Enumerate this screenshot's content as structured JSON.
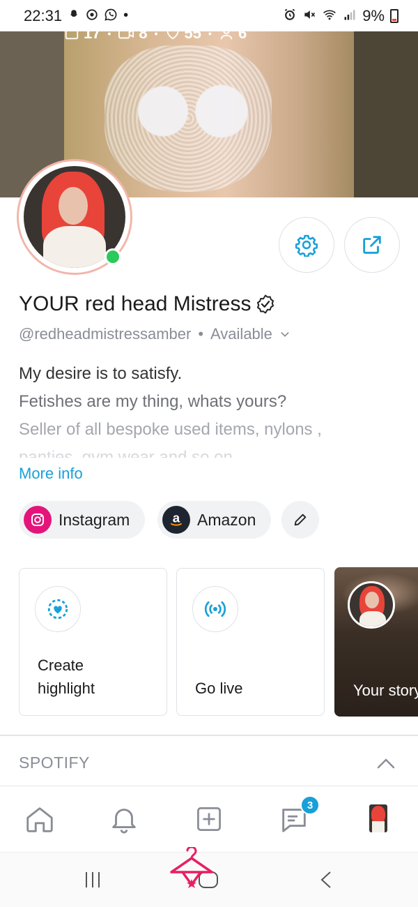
{
  "status_bar": {
    "time": "22:31",
    "left_icons": [
      "snapchat-icon",
      "chrome-icon",
      "whatsapp-icon"
    ],
    "left_dot": "•",
    "right_icons": [
      "alarm-icon",
      "mute-icon",
      "wifi-icon",
      "signal-icon"
    ],
    "battery": "9%"
  },
  "banner": {
    "stats": [
      {
        "icon": "image-icon",
        "value": "17"
      },
      {
        "icon": "video-icon",
        "value": "8"
      },
      {
        "icon": "heart-icon",
        "value": "55"
      },
      {
        "icon": "fans-icon",
        "value": "6"
      }
    ],
    "separator": "•"
  },
  "profile": {
    "name": "YOUR red head Mistress",
    "handle": "@redheadmistressamber",
    "separator": "•",
    "status": "Available",
    "bio_lines": [
      "My desire is to satisfy.",
      "Fetishes are my thing, whats yours?",
      "Seller of all bespoke used items, nylons ,",
      "panties, gym wear and so on"
    ],
    "more_info": "More info",
    "online_color": "#2cc95b"
  },
  "links": [
    {
      "label": "Instagram",
      "icon": "instagram-icon"
    },
    {
      "label": "Amazon",
      "icon": "amazon-icon"
    }
  ],
  "cards": {
    "highlight": {
      "label_line1": "Create",
      "label_line2": "highlight"
    },
    "go_live": {
      "label": "Go live"
    },
    "story": {
      "label": "Your story"
    }
  },
  "spotify": {
    "label": "SPOTIFY"
  },
  "bottom_nav": {
    "items": [
      "home-icon",
      "notifications-icon",
      "add-post-icon",
      "messages-icon",
      "profile-avatar"
    ],
    "messages_badge": "3"
  },
  "colors": {
    "accent": "#1aa0d8",
    "online": "#2cc95b",
    "instagram": "#e4147a"
  }
}
